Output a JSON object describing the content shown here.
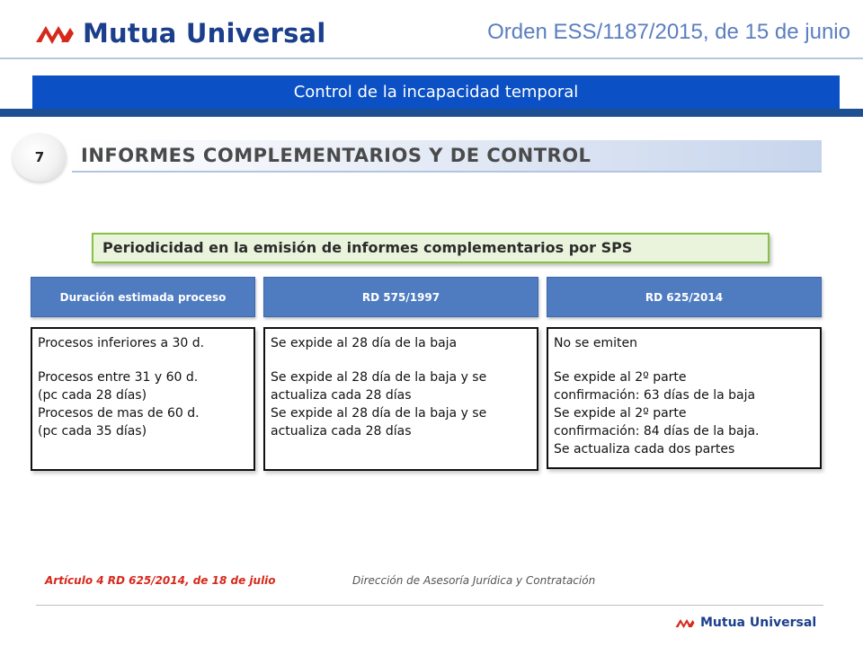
{
  "header": {
    "brand_name": "Mutua Universal",
    "brand_logo": "mutua-universal-logo",
    "order_ref": "Orden ESS/1187/2015, de 15 de junio"
  },
  "banner": {
    "title": "Control de la incapacidad temporal"
  },
  "section": {
    "number": "7",
    "title": "INFORMES COMPLEMENTARIOS  Y DE CONTROL"
  },
  "periodicity": {
    "label": "Periodicidad en la emisión de informes complementarios por SPS"
  },
  "table": {
    "columns": [
      {
        "header": "Duración estimada  proceso",
        "lines": [
          "Procesos inferiores a 30 d.",
          "",
          "Procesos entre 31 y 60 d.",
          "(pc cada 28 días)",
          "Procesos de mas de 60 d.",
          "(pc cada 35 días)"
        ]
      },
      {
        "header": "RD 575/1997",
        "lines": [
          "Se expide al 28 día de la baja",
          "",
          "Se expide al 28 día de la baja y se",
          "actualiza cada 28 días",
          "Se expide al 28 día de la baja y se",
          "actualiza cada 28 días"
        ]
      },
      {
        "header": "RD 625/2014",
        "lines": [
          "No se emiten",
          "",
          "Se expide al 2º parte",
          "confirmación: 63 días de la baja",
          "Se expide al 2º parte",
          "confirmación: 84 días de la baja.",
          "Se actualiza cada dos partes"
        ]
      }
    ]
  },
  "footer": {
    "article": "Artículo  4 RD 625/2014, de 18 de julio",
    "department": "Dirección de Asesoría Jurídica y Contratación",
    "brand_name": "Mutua Universal"
  },
  "colors": {
    "brand_blue": "#1b3f8c",
    "banner_blue": "#0b50c4",
    "header_blue": "#4f7cc0",
    "brand_red": "#d6281b",
    "green_border": "#86c246"
  }
}
